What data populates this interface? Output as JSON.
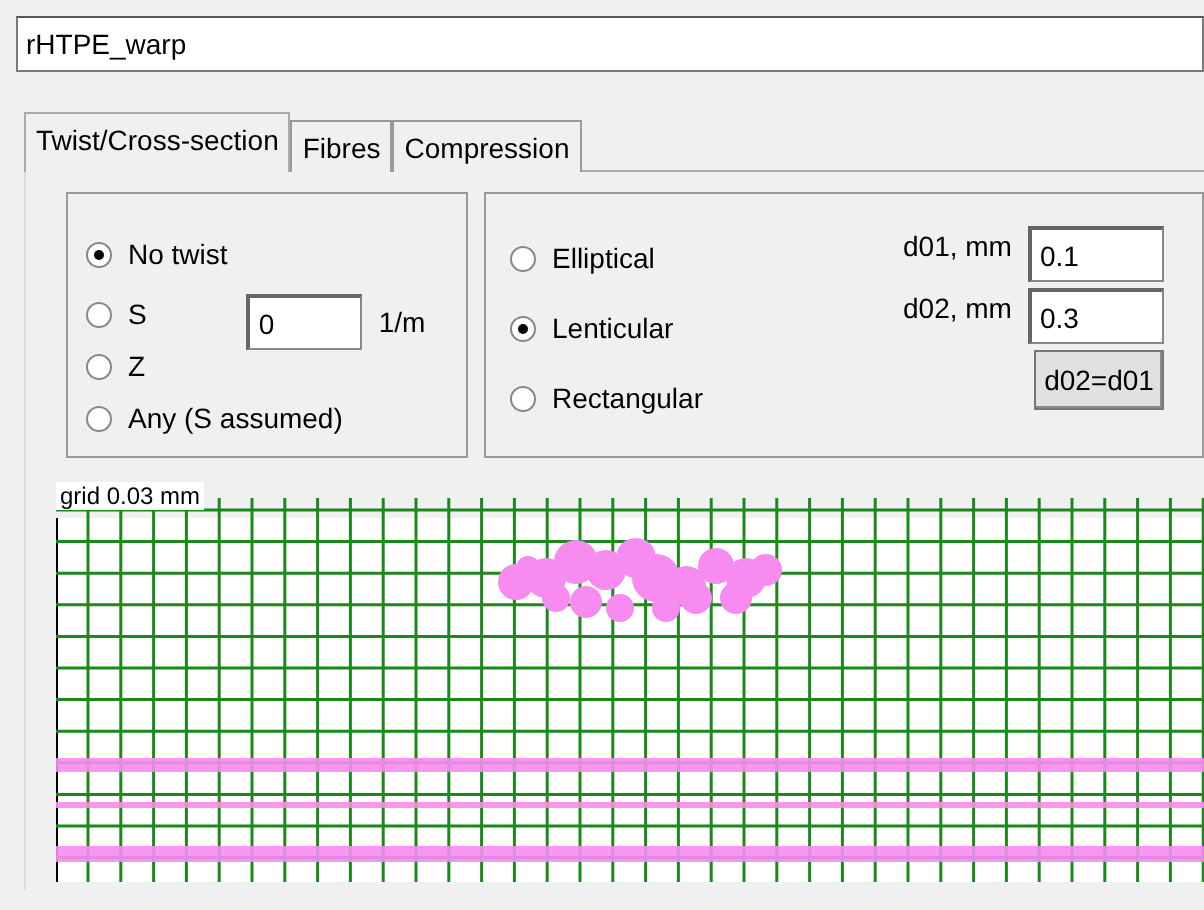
{
  "name_field": {
    "value": "rHTPE_warp"
  },
  "tabs": [
    {
      "label": "Twist/Cross-section",
      "selected": true
    },
    {
      "label": "Fibres",
      "selected": false
    },
    {
      "label": "Compression",
      "selected": false
    }
  ],
  "twist": {
    "options": [
      {
        "label": "No twist",
        "selected": true
      },
      {
        "label": "S",
        "selected": false
      },
      {
        "label": "Z",
        "selected": false
      },
      {
        "label": "Any (S assumed)",
        "selected": false
      }
    ],
    "value": "0",
    "unit": "1/m"
  },
  "cross_section": {
    "options": [
      {
        "label": "Elliptical",
        "selected": false
      },
      {
        "label": "Lenticular",
        "selected": true
      },
      {
        "label": "Rectangular",
        "selected": false
      }
    ],
    "fields": [
      {
        "label": "d01, mm",
        "value": "0.1"
      },
      {
        "label": "d02, mm",
        "value": "0.3"
      }
    ],
    "button": "d02=d01"
  },
  "canvas": {
    "grid_label": "grid 0.03 mm"
  }
}
